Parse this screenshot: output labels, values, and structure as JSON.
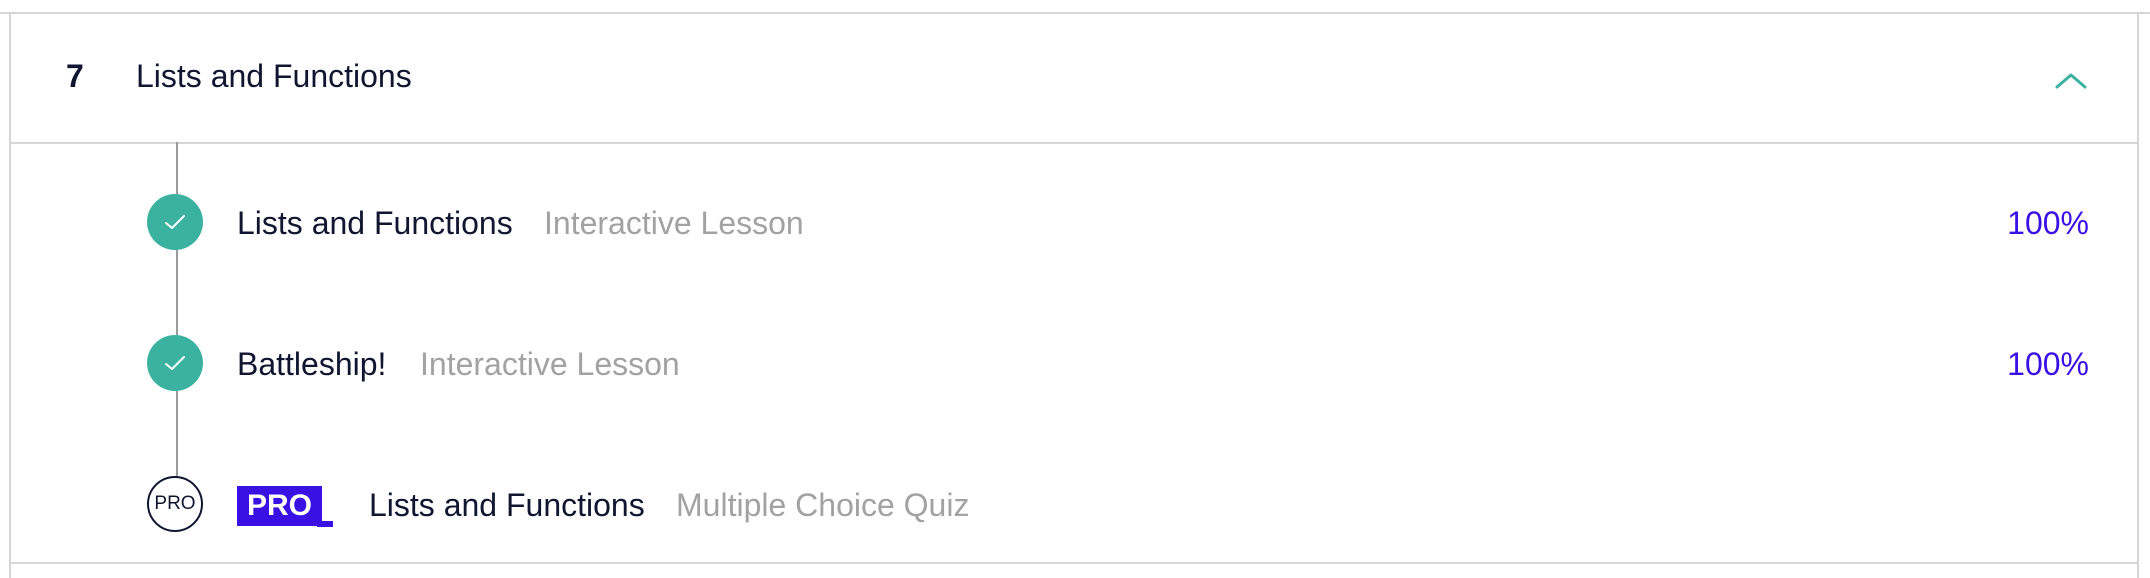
{
  "module": {
    "number": "7",
    "title": "Lists and Functions",
    "expanded": true
  },
  "lessons": [
    {
      "title": "Lists and Functions",
      "type": "Interactive Lesson",
      "progress": "100%",
      "status": "complete"
    },
    {
      "title": "Battleship!",
      "type": "Interactive Lesson",
      "progress": "100%",
      "status": "complete"
    },
    {
      "badge": "PRO",
      "status_label": "PRO",
      "title": "Lists and Functions",
      "type": "Multiple Choice Quiz",
      "status": "pro-locked"
    }
  ],
  "colors": {
    "text": "#10162f",
    "muted": "#a2a2a2",
    "complete": "#3bb2a0",
    "accent": "#3a10e5"
  },
  "icons": {
    "collapse": "chevron-up-icon",
    "complete": "checkmark-icon"
  }
}
